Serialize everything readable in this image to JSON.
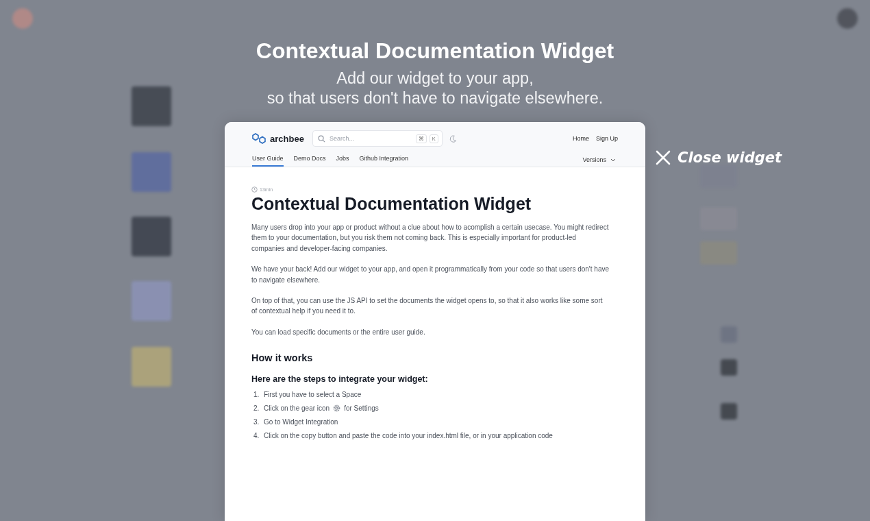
{
  "headline": {
    "title": "Contextual Documentation Widget",
    "subtitle_lines": [
      "Add our widget to your app,",
      "so that users don't have to navigate elsewhere."
    ]
  },
  "close_widget": {
    "label": "Close widget"
  },
  "widget": {
    "logo": "archbee",
    "search": {
      "placeholder": "Search...",
      "keys": [
        "⌘",
        "K"
      ]
    },
    "nav_links": [
      "Home",
      "Sign Up"
    ],
    "tabs": [
      {
        "label": "User Guide",
        "selected": true
      },
      {
        "label": "Demo Docs",
        "selected": false
      },
      {
        "label": "Jobs",
        "selected": false
      },
      {
        "label": "Github Integration",
        "selected": false
      }
    ],
    "versions": "Versions",
    "read_time": "13min",
    "title": "Contextual Documentation Widget",
    "paragraphs": [
      "Many users drop into your app or product without a clue about how to acomplish a certain usecase. You might redirect them to your documentation, but you risk them not coming back. This is especially important for product-led companies and developer-facing companies.",
      "We have your back! Add our widget to your app, and open it programmatically from your code so that users don't have to navigate elsewhere.",
      "On top of that, you can use the JS API to set the documents the widget opens to, so that it also works like some sort of contextual help if you need it to.",
      "You can load specific documents or the entire user guide."
    ],
    "section_heading": "How it works",
    "subheading": "Here are the steps to integrate your widget:",
    "steps": [
      {
        "number": "1.",
        "text": "First you have to select a Space"
      },
      {
        "number": "2.",
        "text": "Click on the gear icon",
        "after": "for Settings"
      },
      {
        "number": "3.",
        "text": "Go to Widget Integration"
      },
      {
        "number": "4.",
        "text": "Click on the copy button and paste the code into your index.html file, or in your application code"
      }
    ]
  }
}
